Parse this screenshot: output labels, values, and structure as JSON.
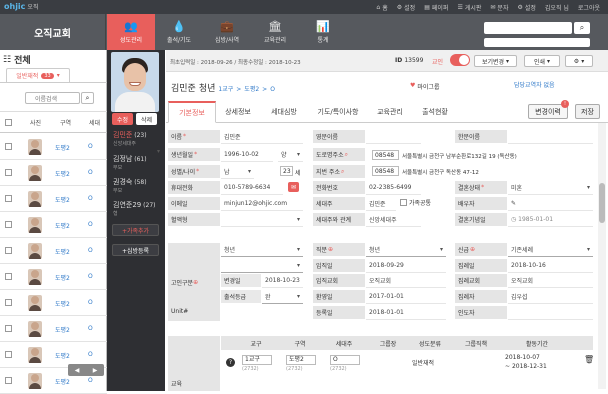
{
  "topbar": {
    "logo_text": "ohjic",
    "logo_sub": "오직",
    "links": [
      "홈",
      "설정",
      "페이퍼",
      "게시판",
      "문자",
      "설정",
      "김오직 님",
      "로그아웃"
    ]
  },
  "header": {
    "church": "오직교회",
    "nav": [
      {
        "label": "성도관리",
        "icon": "people-icon"
      },
      {
        "label": "출석/기도",
        "icon": "drop-icon"
      },
      {
        "label": "심방/사역",
        "icon": "briefcase-icon"
      },
      {
        "label": "교육관리",
        "icon": "bank-icon"
      },
      {
        "label": "통계",
        "icon": "chart-icon"
      }
    ],
    "active_index": 0
  },
  "left": {
    "title": "전체",
    "tab_label": "일반재적",
    "tab_count": "33",
    "search_placeholder": "이름검색",
    "columns": [
      "사진",
      "구역",
      "세대"
    ],
    "rows": [
      {
        "dist": "도평2",
        "o": "O"
      },
      {
        "dist": "도평2",
        "o": "O"
      },
      {
        "dist": "도평2",
        "o": "O"
      },
      {
        "dist": "도평2",
        "o": "O"
      },
      {
        "dist": "도평2",
        "o": "O"
      },
      {
        "dist": "도평2",
        "o": "O"
      },
      {
        "dist": "도평2",
        "o": "O"
      },
      {
        "dist": "도평2",
        "o": "O"
      },
      {
        "dist": "도평2",
        "o": "O"
      },
      {
        "dist": "도평2",
        "o": "O"
      }
    ]
  },
  "family": {
    "edit": "수정",
    "delete": "삭제",
    "members": [
      {
        "name": "김민준",
        "age": "(23)",
        "sub": "신앙세대주",
        "selected": true
      },
      {
        "name": "김정남",
        "age": "(61)",
        "sub": "부모",
        "selected": false
      },
      {
        "name": "권경숙",
        "age": "(58)",
        "sub": "부모",
        "selected": false
      },
      {
        "name": "김연준29",
        "age": "(27)",
        "sub": "형",
        "selected": false
      }
    ],
    "add_family": "+가족추가",
    "add_visit": "+심방등록"
  },
  "infobar": {
    "dates": "최초입력일 : 2018-09-26 / 최종수정일 : 2018-10-23",
    "id_label": "ID",
    "id_value": "13599",
    "gongin": "교인",
    "btn_view": "보기변경",
    "btn_print": "인쇄",
    "btn_more": "설정"
  },
  "member": {
    "name": "김민준",
    "title": "청년",
    "group1": "1교구",
    "group2": "도평2",
    "o": "O",
    "mygroup": "마이그룹",
    "manager": "담당교역자 없음"
  },
  "tabs": [
    "기본정보",
    "상세정보",
    "세대심방",
    "기도/특이사항",
    "교육관리",
    "출석현황"
  ],
  "buttons": {
    "history": "변경이력",
    "history_badge": "!",
    "save": "저장"
  },
  "form": {
    "name_label": "이름",
    "name_value": "김민준",
    "birth_label": "생년월일",
    "birth_value": "1996-10-02",
    "birth_cal": "양",
    "gender_label": "성별/나이",
    "gender_value": "남",
    "age_value": "23",
    "age_unit": "세",
    "mobile_label": "휴대전화",
    "mobile_value": "010-5789-6634",
    "email_label": "이메일",
    "email_value": "minjun12@ohjic.com",
    "blood_label": "혈액형",
    "eng_label": "영문이름",
    "hanja_label": "한문이름",
    "addr_label": "도로명주소",
    "addr_zip": "08548",
    "addr_value": "서울특별시 금천구 남부순환로132길 19 (독산동)",
    "jibun_label": "지번 주소",
    "jibun_zip": "08548",
    "jibun_value": "서울특별시 금천구 독산동 47-12",
    "phone_label": "전화번호",
    "phone_value": "02-2385-6499",
    "head_label": "세대주",
    "head_value": "김민준",
    "family_share": "가족공통",
    "rel_label": "세대주와 관계",
    "rel_value": "신앙세대주",
    "marry_label": "결혼상태",
    "marry_value": "미혼",
    "spouse_label": "배우자",
    "anniv_label": "결혼기념일",
    "anniv_value": "1985-01-01",
    "cat_label": "고인구분",
    "cat_value": "청년",
    "pos_label": "직분",
    "pos_value": "청년",
    "appoint_label": "임직일",
    "appoint_value": "2018-09-29",
    "appointed_label": "임직교회",
    "appointed_value": "오직교회",
    "baptism_label": "환영일",
    "baptism_value": "2017-01-01",
    "reg_label": "등록일",
    "reg_value": "2018-01-01",
    "newcomer_label": "신급",
    "newcomer_value": "기존세례",
    "baptize_label": "집례일",
    "baptize_value": "2018-10-16",
    "baptize_church_label": "집례교회",
    "baptize_church_value": "오직교회",
    "officiant_label": "집례자",
    "officiant_value": "김우섭",
    "guide_label": "인도자",
    "change_label": "변경일",
    "change_value": "2018-10-23",
    "attend_label": "출석등급",
    "attend_value": "완",
    "unit_label": "Unit#"
  },
  "group_table": {
    "headers": [
      "교구",
      "구역",
      "세대주",
      "그룹장",
      "성도분류",
      "그룹직책",
      "활동기간"
    ],
    "row": {
      "parish": "1교구",
      "parish_sub": "(2732)",
      "district": "도평2",
      "district_sub": "(2732)",
      "head": "O",
      "head_sub": "(2732)",
      "class": "일반재적",
      "period_start": "2018-10-07",
      "period_end": "2018-12-31"
    },
    "side_label": "교육"
  }
}
